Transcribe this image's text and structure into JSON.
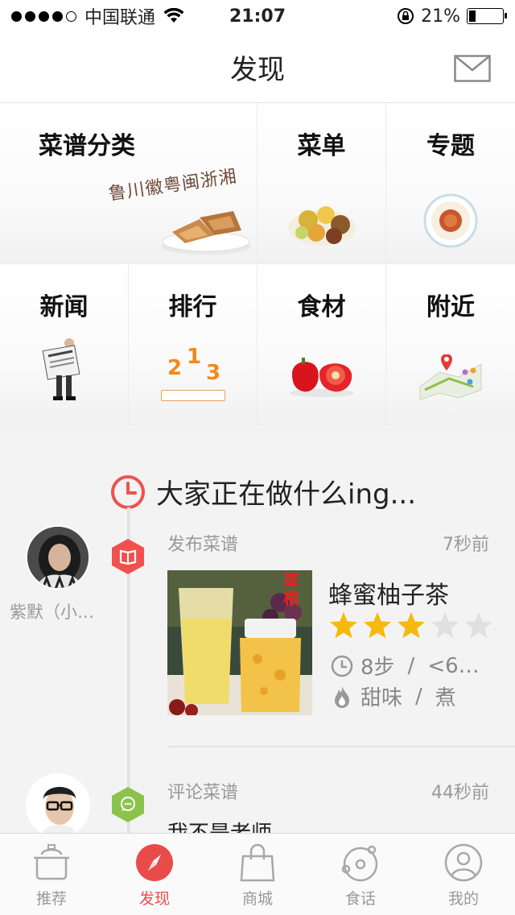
{
  "status_bar": {
    "carrier": "中国联通",
    "time": "21:07",
    "battery": "21%",
    "battery_level": 0.21
  },
  "nav": {
    "title": "发现",
    "mail_icon": "mail-icon"
  },
  "grid": {
    "tiles": [
      {
        "label": "菜谱分类",
        "icon": "cuisine-category-image",
        "art_text": "鲁川徽粤闽浙湘"
      },
      {
        "label": "菜单",
        "icon": "menu-dishes-image"
      },
      {
        "label": "专题",
        "icon": "topic-plate-image"
      },
      {
        "label": "新闻",
        "icon": "newspaper-man-image"
      },
      {
        "label": "排行",
        "icon": "ranking-podium-image",
        "podium": [
          "2",
          "1",
          "3"
        ]
      },
      {
        "label": "食材",
        "icon": "peppers-image"
      },
      {
        "label": "附近",
        "icon": "map-pins-image"
      }
    ]
  },
  "feed": {
    "title": "大家正在做什么ing...",
    "clock_icon": "clock-icon",
    "items": [
      {
        "username": "紫默（小…",
        "type": "发布菜谱",
        "time": "7秒前",
        "recipe_name": "蜂蜜柚子茶",
        "image_badge_text": "草根",
        "rating": 3,
        "max_rating": 5,
        "steps": "8步",
        "separator": "/",
        "duration": "<6…",
        "taste": "甜味",
        "method": "煮",
        "badge_icon": "book-icon",
        "badge_color": "#f0514f"
      },
      {
        "type": "评论菜谱",
        "time": "44秒前",
        "comment": "我不是老师",
        "badge_icon": "chat-icon",
        "badge_color": "#8bc34a"
      }
    ]
  },
  "tabs": [
    {
      "label": "推荐",
      "icon": "pot-icon",
      "active": false
    },
    {
      "label": "发现",
      "icon": "compass-icon",
      "active": true
    },
    {
      "label": "商城",
      "icon": "shopping-bag-icon",
      "active": false
    },
    {
      "label": "食话",
      "icon": "planet-icon",
      "active": false
    },
    {
      "label": "我的",
      "icon": "user-icon",
      "active": false
    }
  ],
  "colors": {
    "accent": "#e94b4b",
    "star_on": "#f5b90f",
    "star_off": "#e0e0e0"
  }
}
